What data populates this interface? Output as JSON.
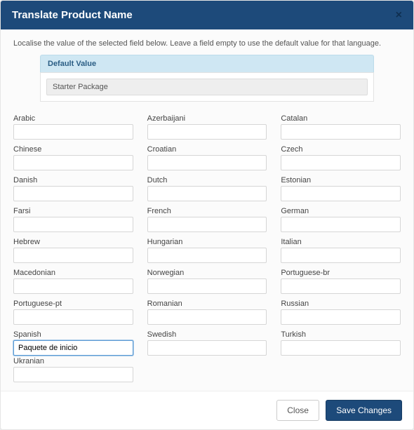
{
  "header": {
    "title": "Translate Product Name",
    "close": "×"
  },
  "body": {
    "instruction": "Localise the value of the selected field below. Leave a field empty to use the default value for that language.",
    "default_label": "Default Value",
    "default_value": "Starter Package",
    "languages": [
      {
        "key": "arabic",
        "label": "Arabic",
        "value": ""
      },
      {
        "key": "azerbaijani",
        "label": "Azerbaijani",
        "value": ""
      },
      {
        "key": "catalan",
        "label": "Catalan",
        "value": ""
      },
      {
        "key": "chinese",
        "label": "Chinese",
        "value": ""
      },
      {
        "key": "croatian",
        "label": "Croatian",
        "value": ""
      },
      {
        "key": "czech",
        "label": "Czech",
        "value": ""
      },
      {
        "key": "danish",
        "label": "Danish",
        "value": ""
      },
      {
        "key": "dutch",
        "label": "Dutch",
        "value": ""
      },
      {
        "key": "estonian",
        "label": "Estonian",
        "value": ""
      },
      {
        "key": "farsi",
        "label": "Farsi",
        "value": ""
      },
      {
        "key": "french",
        "label": "French",
        "value": ""
      },
      {
        "key": "german",
        "label": "German",
        "value": ""
      },
      {
        "key": "hebrew",
        "label": "Hebrew",
        "value": ""
      },
      {
        "key": "hungarian",
        "label": "Hungarian",
        "value": ""
      },
      {
        "key": "italian",
        "label": "Italian",
        "value": ""
      },
      {
        "key": "macedonian",
        "label": "Macedonian",
        "value": ""
      },
      {
        "key": "norwegian",
        "label": "Norwegian",
        "value": ""
      },
      {
        "key": "portuguese-br",
        "label": "Portuguese-br",
        "value": ""
      },
      {
        "key": "portuguese-pt",
        "label": "Portuguese-pt",
        "value": ""
      },
      {
        "key": "romanian",
        "label": "Romanian",
        "value": ""
      },
      {
        "key": "russian",
        "label": "Russian",
        "value": ""
      },
      {
        "key": "spanish",
        "label": "Spanish",
        "value": "Paquete de inicio",
        "focused": true
      },
      {
        "key": "swedish",
        "label": "Swedish",
        "value": ""
      },
      {
        "key": "turkish",
        "label": "Turkish",
        "value": ""
      },
      {
        "key": "ukranian",
        "label": "Ukranian",
        "value": ""
      }
    ]
  },
  "footer": {
    "close_label": "Close",
    "save_label": "Save Changes"
  }
}
